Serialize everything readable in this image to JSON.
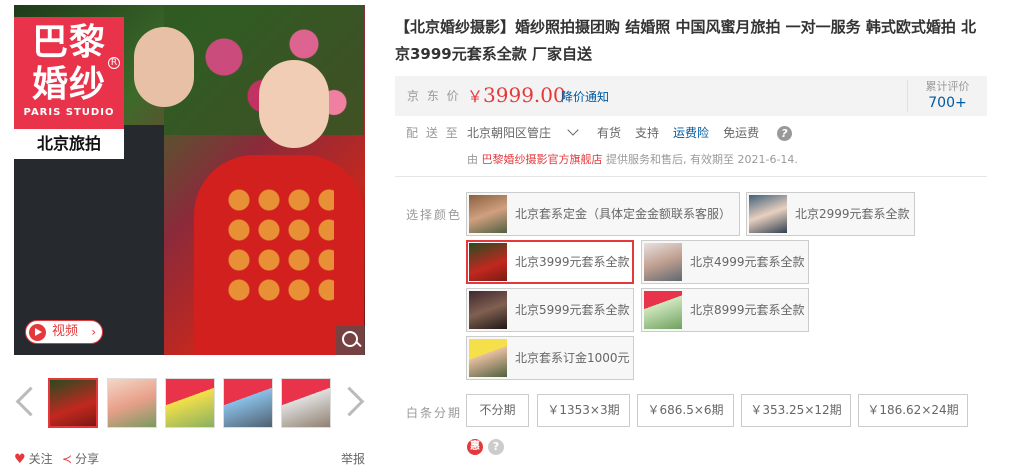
{
  "gallery": {
    "logo_brand": "巴黎婚纱",
    "logo_sub": "PARIS STUDIO",
    "logo_tag": "北京旅拍",
    "logo_reg": "R",
    "video_label": "视频",
    "thumbnail_count": 5,
    "active_thumbnail": 1,
    "follow_label": "关注",
    "share_label": "分享",
    "report_label": "举报"
  },
  "product": {
    "title": "【北京婚纱摄影】婚纱照拍摄团购 结婚照 中国风蜜月旅拍 一对一服务 韩式欧式婚拍 北京3999元套系全款 厂家自送"
  },
  "price": {
    "label": "京 东 价",
    "currency": "￥",
    "amount": "3999.00",
    "notify_label": "降价通知",
    "rating_label": "累计评价",
    "rating_value": "700+"
  },
  "delivery": {
    "label": "配 送 至",
    "location": "北京朝阳区管庄",
    "stock": "有货",
    "support": "支持",
    "insurance": "运费险",
    "free_shipping": "免运费",
    "seller_prefix": "由 ",
    "seller_name": "巴黎婚纱摄影官方旗舰店",
    "seller_suffix": " 提供服务和售后, 有效期至 2021-6-14."
  },
  "selection": {
    "label": "选择颜色",
    "options": [
      {
        "label": "北京套系定金（具体定金金额联系客服）",
        "selected": false
      },
      {
        "label": "北京2999元套系全款",
        "selected": false
      },
      {
        "label": "北京3999元套系全款",
        "selected": true
      },
      {
        "label": "北京4999元套系全款",
        "selected": false
      },
      {
        "label": "北京5999元套系全款",
        "selected": false
      },
      {
        "label": "北京8999元套系全款",
        "selected": false
      },
      {
        "label": "北京套系订金1000元",
        "selected": false
      }
    ]
  },
  "baitiao": {
    "label": "白条分期",
    "options": [
      "不分期",
      "￥1353×3期",
      "￥686.5×6期",
      "￥353.25×12期",
      "￥186.62×24期"
    ],
    "hui_icon": "惠",
    "help_icon": "?"
  },
  "colors": {
    "accent": "#e4393c",
    "link": "#005aa0",
    "logo_pink": "#e8334a"
  }
}
